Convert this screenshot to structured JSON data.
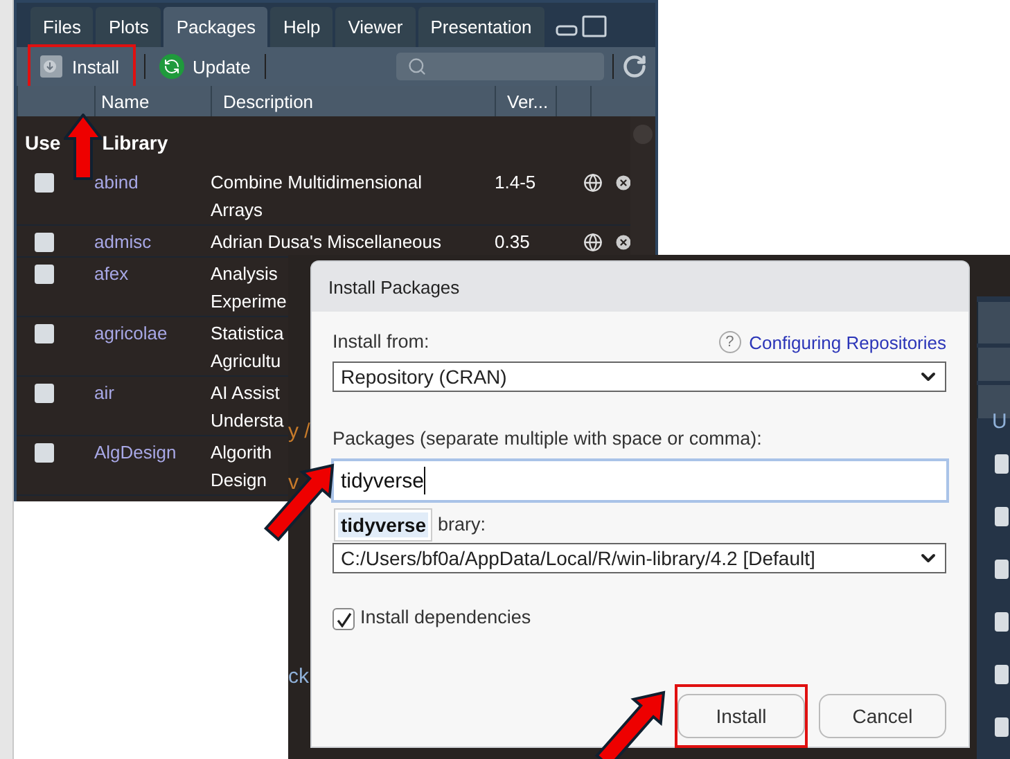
{
  "packages_pane": {
    "tabs": [
      {
        "label": "Files",
        "selected": false
      },
      {
        "label": "Plots",
        "selected": false
      },
      {
        "label": "Packages",
        "selected": true
      },
      {
        "label": "Help",
        "selected": false
      },
      {
        "label": "Viewer",
        "selected": false
      },
      {
        "label": "Presentation",
        "selected": false
      }
    ],
    "toolbar": {
      "install": {
        "label": "Install",
        "highlighted": true
      },
      "update": "Update"
    },
    "columns": [
      "Name",
      "Description",
      "Ver..."
    ],
    "section": [
      "Use",
      "Library"
    ],
    "rows": [
      {
        "checked": false,
        "name": "abind",
        "description": [
          "Combine Multidimensional",
          "Arrays"
        ],
        "version": "1.4-5"
      },
      {
        "checked": false,
        "name": "admisc",
        "description": [
          "Adrian Dusa's Miscellaneous"
        ],
        "version": "0.35"
      },
      {
        "checked": false,
        "name": "afex",
        "description": [
          "Analysis",
          "Experime"
        ]
      },
      {
        "checked": false,
        "name": "agricolae",
        "description": [
          "Statistica",
          "Agricultu"
        ]
      },
      {
        "checked": false,
        "name": "air",
        "description": [
          "AI Assist",
          "Understa"
        ]
      },
      {
        "checked": false,
        "name": "AlgDesign",
        "description": [
          "Algorith",
          "Design"
        ]
      }
    ]
  },
  "background_window": {
    "fragments": [
      "y /",
      "v",
      "ck",
      "U"
    ],
    "checkboxes": [
      {
        "checked": false
      },
      {
        "checked": false
      },
      {
        "checked": false
      },
      {
        "checked": false
      },
      {
        "checked": false
      },
      {
        "checked": false
      }
    ]
  },
  "dialog": {
    "title": "Install Packages",
    "install_from_label": "Install from:",
    "help_icon": "?",
    "help_link": "Configuring Repositories",
    "install_from": "Repository (CRAN)",
    "packages_label": "Packages (separate multiple with space or comma):",
    "packages_value": "tidyverse",
    "suggestion": "tidyverse",
    "library_label": "brary:",
    "library": "C:/Users/bf0a/AppData/Local/R/win-library/4.2 [Default]",
    "dependencies": {
      "label": "Install dependencies",
      "checked": true
    },
    "buttons": [
      {
        "label": "Install",
        "highlighted": true
      },
      {
        "label": "Cancel",
        "highlighted": false
      }
    ]
  }
}
